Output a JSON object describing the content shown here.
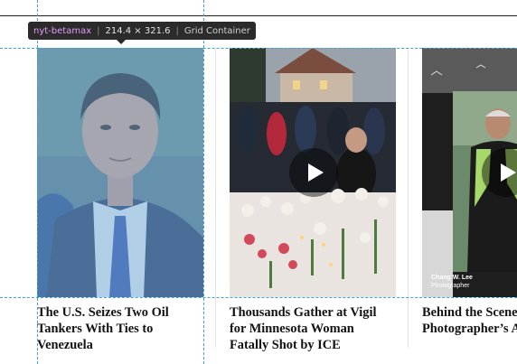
{
  "devtools": {
    "tag": "nyt-betamax",
    "dimensions": "214.4 × 321.6",
    "element_type": "Grid Container"
  },
  "cards": [
    {
      "headline": "The U.S. Seizes Two Oil Tankers With Ties to Venezuela",
      "media_type": "photo"
    },
    {
      "headline": "Thousands Gather at Vigil for Minnesota Woman Fatally Shot by ICE",
      "media_type": "video"
    },
    {
      "headline": "Behind the Scenes Photographer’s An Journey",
      "media_type": "video",
      "credit_name": "Chang W. Lee",
      "credit_role": "Photographer"
    }
  ],
  "colors": {
    "inspect_overlay": "#6fa8dc",
    "guide_lines": "#3ea2d8",
    "headline_text": "#121212"
  },
  "icons": [
    "play-icon"
  ]
}
